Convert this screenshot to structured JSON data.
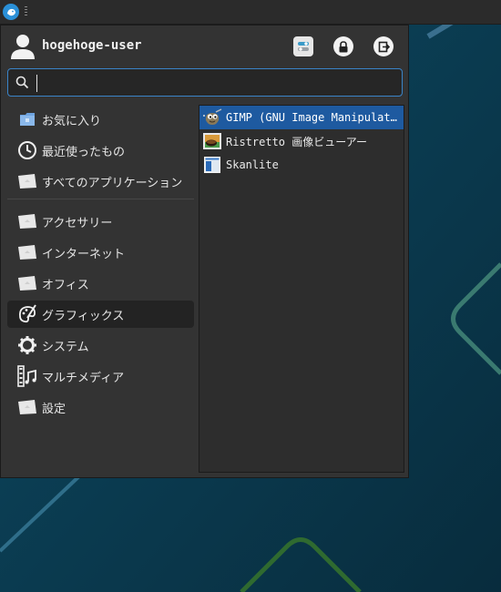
{
  "panel": {
    "menu_button_icon": "whisker-menu-icon"
  },
  "user": {
    "name": "hogehoge-user"
  },
  "actions": {
    "settings_icon": "settings-icon",
    "lock_icon": "lock-icon",
    "logout_icon": "logout-icon"
  },
  "search": {
    "value": "",
    "placeholder": ""
  },
  "categories": [
    {
      "label": "お気に入り",
      "icon": "favorites-icon"
    },
    {
      "label": "最近使ったもの",
      "icon": "clock-icon"
    },
    {
      "label": "すべてのアプリケーション",
      "icon": "all-apps-icon"
    },
    {
      "label": "アクセサリー",
      "icon": "accessories-icon"
    },
    {
      "label": "インターネット",
      "icon": "internet-icon"
    },
    {
      "label": "オフィス",
      "icon": "office-icon"
    },
    {
      "label": "グラフィックス",
      "icon": "graphics-icon",
      "selected": true
    },
    {
      "label": "システム",
      "icon": "gear-icon"
    },
    {
      "label": "マルチメディア",
      "icon": "multimedia-icon"
    },
    {
      "label": "設定",
      "icon": "settings-category-icon"
    }
  ],
  "apps": [
    {
      "label": "GIMP (GNU Image Manipulat…",
      "icon": "gimp-icon",
      "selected": true
    },
    {
      "label": "Ristretto 画像ビューアー",
      "icon": "ristretto-icon"
    },
    {
      "label": "Skanlite",
      "icon": "skanlite-icon"
    }
  ],
  "colors": {
    "accent": "#1e5aa0",
    "search_border": "#3a84c8",
    "desktop": "#0b3f55"
  }
}
